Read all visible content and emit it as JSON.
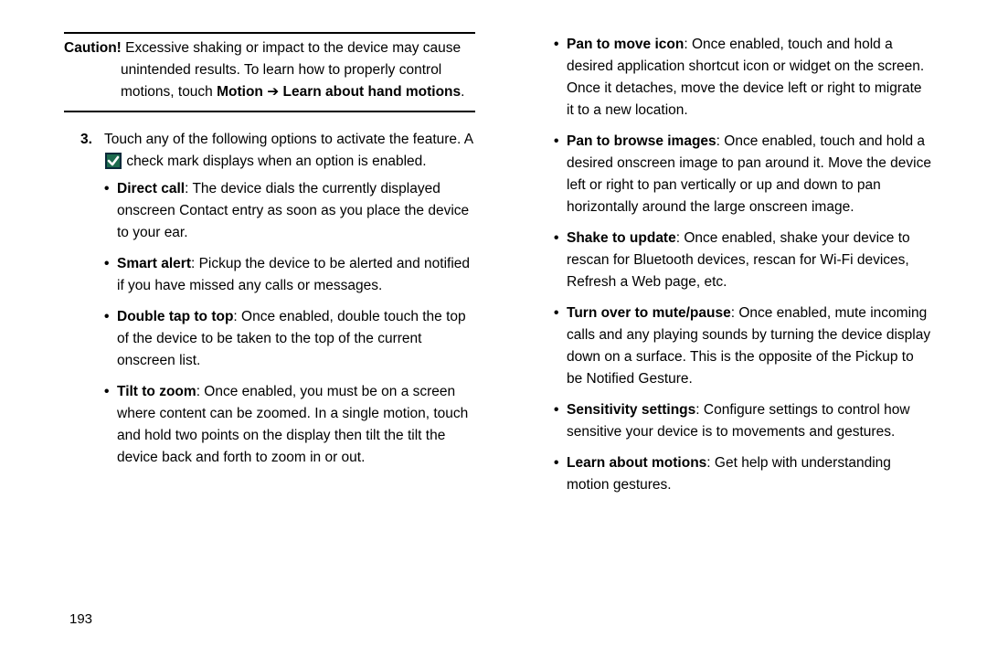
{
  "caution": {
    "label": "Caution!",
    "text_prefix": " Excessive shaking or impact to the device may cause unintended results. To learn how to properly control motions, touch ",
    "bold1": "Motion",
    "arrow": " ➔ ",
    "bold2": "Learn about hand motions",
    "period": "."
  },
  "step": {
    "num": "3.",
    "pre": "Touch any of the following options to activate the feature. A ",
    "post": " check mark displays when an option is enabled."
  },
  "left_items": [
    {
      "title": "Direct call",
      "text": ": The device dials the currently displayed onscreen Contact entry as soon as you place the device to your ear."
    },
    {
      "title": "Smart alert",
      "text": ": Pickup the device to be alerted and notified if you have missed any calls or messages."
    },
    {
      "title": "Double tap to top",
      "text": ": Once enabled, double touch the top of the device to be taken to the top of the current onscreen list."
    },
    {
      "title": "Tilt to zoom",
      "text": ": Once enabled, you must be on a screen where content can be zoomed. In a single motion, touch and hold two points on the display then tilt the tilt the device back and forth to zoom in or out."
    }
  ],
  "right_items": [
    {
      "title": "Pan to move icon",
      "text": ": Once enabled, touch and hold a desired application shortcut icon or widget on the screen. Once it detaches, move the device left or right to migrate it to a new location."
    },
    {
      "title": "Pan to browse images",
      "text": ": Once enabled, touch and hold a desired onscreen image to pan around it. Move the device left or right to pan vertically or up and down to pan horizontally around the large onscreen image."
    },
    {
      "title": "Shake to update",
      "text": ": Once enabled, shake your device to rescan for Bluetooth devices, rescan for Wi-Fi devices, Refresh a Web page, etc."
    },
    {
      "title": "Turn over to mute/pause",
      "text": ": Once enabled, mute incoming calls and any playing sounds by turning the device display down on a surface. This is the opposite of the Pickup to be Notified Gesture."
    },
    {
      "title": "Sensitivity settings",
      "text": ": Configure settings to control how sensitive your device is to movements and gestures."
    },
    {
      "title": "Learn about motions",
      "text": ": Get help with understanding motion gestures."
    }
  ],
  "page_number": "193"
}
